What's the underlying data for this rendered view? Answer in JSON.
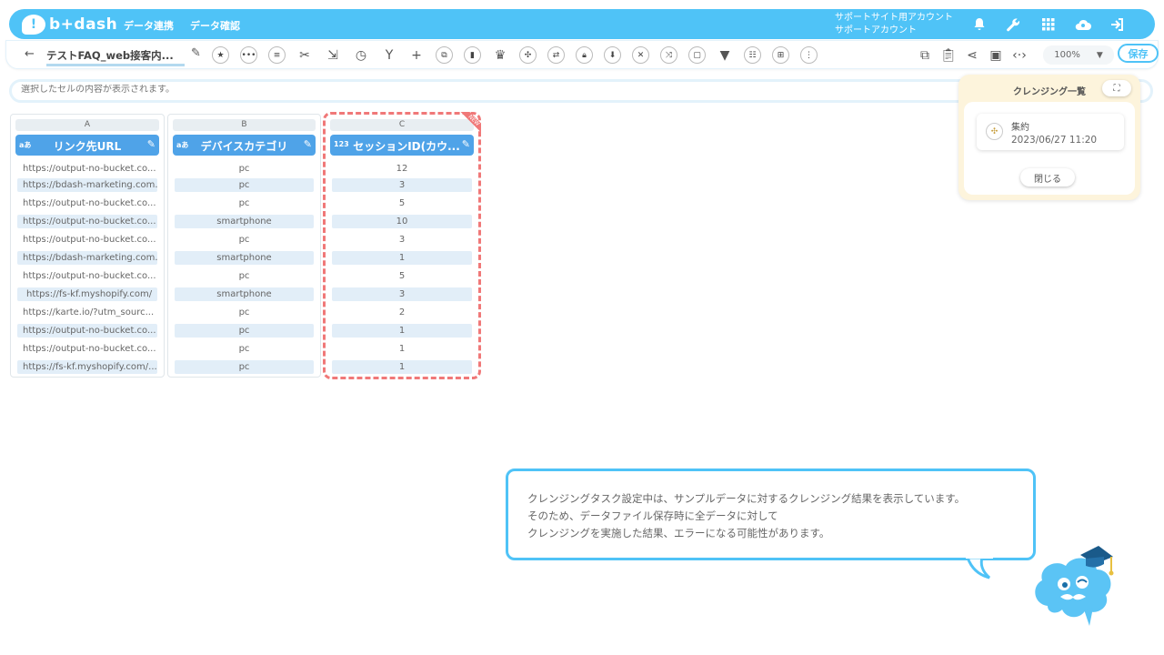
{
  "header": {
    "logo_text": "b+dash",
    "nav": [
      "データ連携",
      "データ確認"
    ],
    "account_line1": "サポートサイト用アカウント",
    "account_line2": "サポートアカウント",
    "icons": [
      "bell-icon",
      "wrench-icon",
      "grid-icon",
      "cloud-user-icon",
      "logout-icon"
    ]
  },
  "toolbar": {
    "back_icon": "←",
    "filename": "テストFAQ_web接客内...",
    "zoom": "100%",
    "save_label": "保存",
    "tool_icons": [
      "star-icon",
      "more-icon",
      "list-icon",
      "tools-icon",
      "merge-icon",
      "timer-icon",
      "branch-icon",
      "plus-icon",
      "copy-icon",
      "delete-icon",
      "crown-icon",
      "shrink-icon",
      "repeat-icon",
      "lock-icon",
      "download-icon",
      "close-circle-icon",
      "shuffle-icon",
      "frame-icon",
      "filter-icon",
      "text-icon",
      "table-icon",
      "split-icon"
    ],
    "right_icons": [
      "flow-icon",
      "clipboard-icon",
      "share-icon",
      "file-search-icon",
      "code-icon"
    ]
  },
  "cellbar": {
    "placeholder": "選択したセルの内容が表示されます。"
  },
  "columns": [
    {
      "letter": "A",
      "type": "aあ",
      "title": "リンク先URL",
      "cells": [
        "https://output-no-bucket.co...",
        "https://bdash-marketing.com...",
        "https://output-no-bucket.co...",
        "https://output-no-bucket.co...",
        "https://output-no-bucket.co...",
        "https://bdash-marketing.com...",
        "https://output-no-bucket.co...",
        "https://fs-kf.myshopify.com/",
        "https://karte.io/?utm_sourc...",
        "https://output-no-bucket.co...",
        "https://output-no-bucket.co...",
        "https://fs-kf.myshopify.com/..."
      ]
    },
    {
      "letter": "B",
      "type": "aあ",
      "title": "デバイスカテゴリ",
      "cells": [
        "pc",
        "pc",
        "pc",
        "smartphone",
        "pc",
        "smartphone",
        "pc",
        "smartphone",
        "pc",
        "pc",
        "pc",
        "pc"
      ]
    },
    {
      "letter": "C",
      "type": "123",
      "title": "セッションID(カウ...",
      "cells": [
        "12",
        "3",
        "5",
        "10",
        "3",
        "1",
        "5",
        "3",
        "2",
        "1",
        "1",
        "1"
      ]
    }
  ],
  "new_badge": "NEW",
  "cleansing_panel": {
    "title": "クレンジング一覧",
    "item_name": "集約",
    "item_date": "2023/06/27 11:20",
    "close_label": "閉じる"
  },
  "notice": {
    "lines": [
      "クレンジングタスク設定中は、サンプルデータに対するクレンジング結果を表示しています。",
      "そのため、データファイル保存時に全データに対して",
      "クレンジングを実施した結果、エラーになる可能性があります。"
    ]
  }
}
